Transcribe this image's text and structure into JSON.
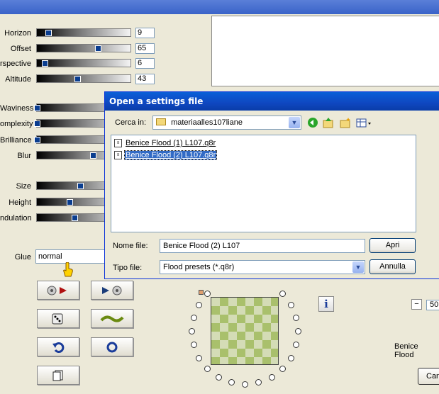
{
  "sliders_top": [
    {
      "label": "Horizon",
      "value": "9",
      "level": 0.12
    },
    {
      "label": "Offset",
      "value": "65",
      "level": 0.65
    },
    {
      "label": "rspective",
      "value": "6",
      "level": 0.08
    },
    {
      "label": "Altitude",
      "value": "43",
      "level": 0.43
    }
  ],
  "sliders_mid": [
    {
      "label": "Waviness",
      "level": 0.0
    },
    {
      "label": "omplexity",
      "level": 0.0
    },
    {
      "label": "Brilliance",
      "level": 0.0
    },
    {
      "label": "Blur",
      "level": 0.6
    }
  ],
  "sliders_low": [
    {
      "label": "Size",
      "level": 0.46
    },
    {
      "label": "Height",
      "level": 0.35
    },
    {
      "label": "ndulation",
      "level": 0.4
    }
  ],
  "glue": {
    "label": "Glue",
    "value": "normal"
  },
  "dialog": {
    "title": "Open a settings file",
    "look_in_label": "Cerca in:",
    "look_in_value": "materiaalles107liane",
    "files": [
      {
        "name": "Benice Flood (1)  L107.q8r",
        "selected": false
      },
      {
        "name": "Benice Flood (2) L107.q8r",
        "selected": true
      }
    ],
    "filename_label": "Nome file:",
    "filename_value": "Benice Flood (2) L107",
    "filetype_label": "Tipo file:",
    "filetype_value": "Flood presets (*.q8r)",
    "open_button": "Apri",
    "cancel_button": "Annulla"
  },
  "right_panel": {
    "preset_text": "Benice Flood",
    "zoom_value": "50",
    "minus": "−",
    "cancel_partial": "Can"
  },
  "info_icon_text": "i",
  "colors": {
    "accent": "#0a3d8f",
    "dialog_title": "#0a5fd8",
    "selection": "#316ac5"
  }
}
